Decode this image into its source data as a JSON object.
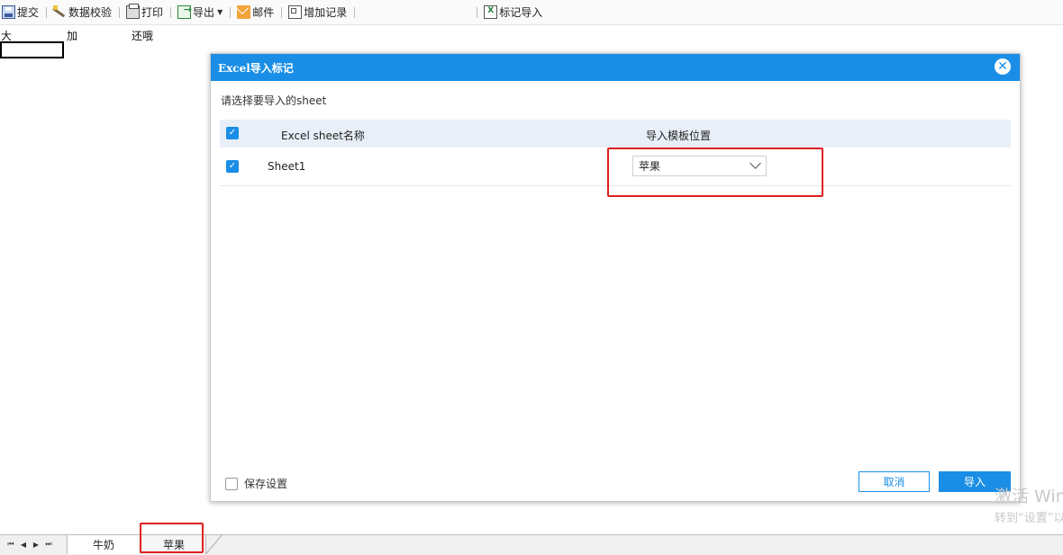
{
  "toolbar": {
    "submit": "提交",
    "verify": "数据校验",
    "print": "打印",
    "export": "导出",
    "mail": "邮件",
    "add_record": "增加记录",
    "mark_import": "标记导入"
  },
  "sheet": {
    "cells": [
      "大",
      "加",
      "还哦"
    ]
  },
  "dialog": {
    "title": "Excel导入标记",
    "prompt": "请选择要导入的sheet",
    "columns": {
      "sheet_name": "Excel sheet名称",
      "template_position": "导入模板位置"
    },
    "rows": [
      {
        "name": "Sheet1",
        "target": "苹果",
        "checked": true
      }
    ],
    "save_setting": "保存设置",
    "cancel": "取消",
    "import": "导入"
  },
  "sheet_tabs": [
    "牛奶",
    "苹果"
  ],
  "watermark": {
    "line1": "激活 Win",
    "line2": "转到“设置”以"
  },
  "colors": {
    "accent": "#1a8ee6",
    "highlight": "#e02020"
  },
  "icons": [
    "save-icon",
    "verify-icon",
    "print-icon",
    "export-icon",
    "mail-icon",
    "add-record-icon",
    "mark-import-icon",
    "close-icon",
    "chevron-down-icon",
    "check-icon"
  ]
}
